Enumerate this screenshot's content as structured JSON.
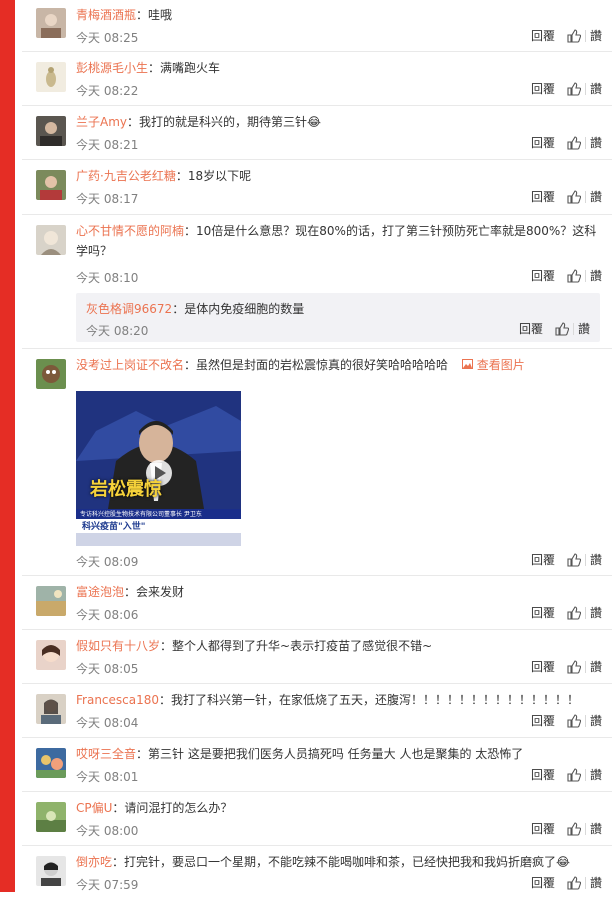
{
  "actions": {
    "reply": "回覆",
    "praise": "讚"
  },
  "comments": [
    {
      "user": "青梅酒酒瓶",
      "text": "：哇哦",
      "time": "今天 08:25"
    },
    {
      "user": "彭桃源毛小生",
      "text": "：满嘴跑火车",
      "time": "今天 08:22"
    },
    {
      "user": "兰子Amy",
      "text": "：我打的就是科兴的，期待第三针😂",
      "time": "今天 08:21"
    },
    {
      "user": "广药·九吉公老红糖",
      "text": "：18岁以下呢",
      "time": "今天 08:17"
    },
    {
      "user": "心不甘情不愿的阿楠",
      "text": "：10倍是什么意思？现在80%的话，打了第三针预防死亡率就是800%？这科学吗？",
      "time": "今天 08:10",
      "reply": {
        "user": "灰色格调96672",
        "text": "：是体内免疫细胞的数量",
        "time": "今天 08:20"
      }
    },
    {
      "user": "没考过上岗证不改名",
      "text": "：虽然但是封面的岩松震惊真的很好笑哈哈哈哈哈",
      "view_pic": "查看图片",
      "time": "今天 08:09",
      "media": {
        "caption": "岩松震惊",
        "banner": "科兴疫苗\"入世\"",
        "sub": "专访科兴控股生物技术有限公司董事长 尹卫东"
      }
    },
    {
      "user": "富途泡泡",
      "text": "：会来发财",
      "time": "今天 08:06"
    },
    {
      "user": "假如只有十八岁",
      "text": "：整个人都得到了升华~表示打疫苗了感觉很不错~",
      "time": "今天 08:05"
    },
    {
      "user": "Francesca180",
      "text": "：我打了科兴第一针，在家低烧了五天，还腹泻！！！！！！！！！！！！！！",
      "time": "今天 08:04"
    },
    {
      "user": "哎呀三全音",
      "text": "：第三针 这是要把我们医务人员搞死吗 任务量大 人也是聚集的 太恐怖了",
      "time": "今天 08:01"
    },
    {
      "user": "CP偏U",
      "text": "：请问混打的怎么办？",
      "time": "今天 08:00"
    },
    {
      "user": "倒亦吃",
      "text": "：打完针，要忌口一个星期，不能吃辣不能喝咖啡和茶，已经快把我和我妈折磨疯了😂",
      "time": "今天 07:59"
    }
  ]
}
